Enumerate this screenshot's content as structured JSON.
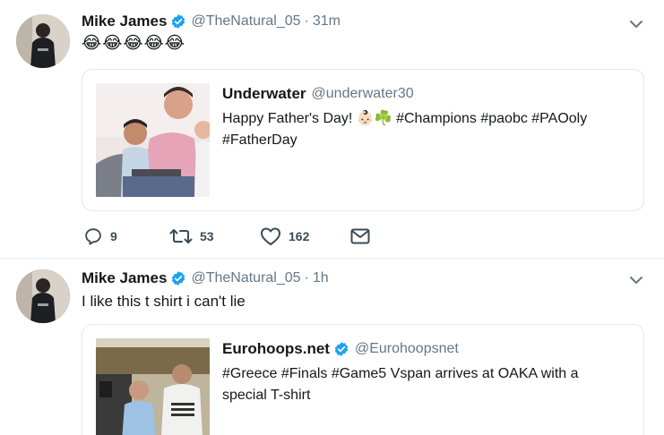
{
  "colors": {
    "verified": "#1da1f2",
    "name_text": "#14171a",
    "secondary_text": "#657786",
    "action_icon": "#3b4a57",
    "border": "#e1e8ed"
  },
  "tweets": [
    {
      "author_name": "Mike James",
      "verified_icon": "verified-badge-icon",
      "handle": "@TheNatural_05",
      "separator": "·",
      "time": "31m",
      "text": "😂😂😂😂😂",
      "quote": {
        "author_name": "Underwater",
        "handle": "@underwater30",
        "text_line1": "Happy Father's Day! 👶🏻☘️ #Champions #paobc #PAOoly",
        "text_line2": "#FatherDay"
      },
      "actions": {
        "reply_count": "9",
        "retweet_count": "53",
        "like_count": "162"
      }
    },
    {
      "author_name": "Mike James",
      "verified_icon": "verified-badge-icon",
      "handle": "@TheNatural_05",
      "separator": "·",
      "time": "1h",
      "text": "I like this t shirt i can't lie",
      "quote": {
        "author_name": "Eurohoops.net",
        "verified_icon": "verified-badge-icon",
        "handle": "@Eurohoopsnet",
        "text_line1": "#Greece #Finals #Game5 Vspan arrives at OAKA with a",
        "text_line2": "special T-shirt"
      }
    }
  ]
}
